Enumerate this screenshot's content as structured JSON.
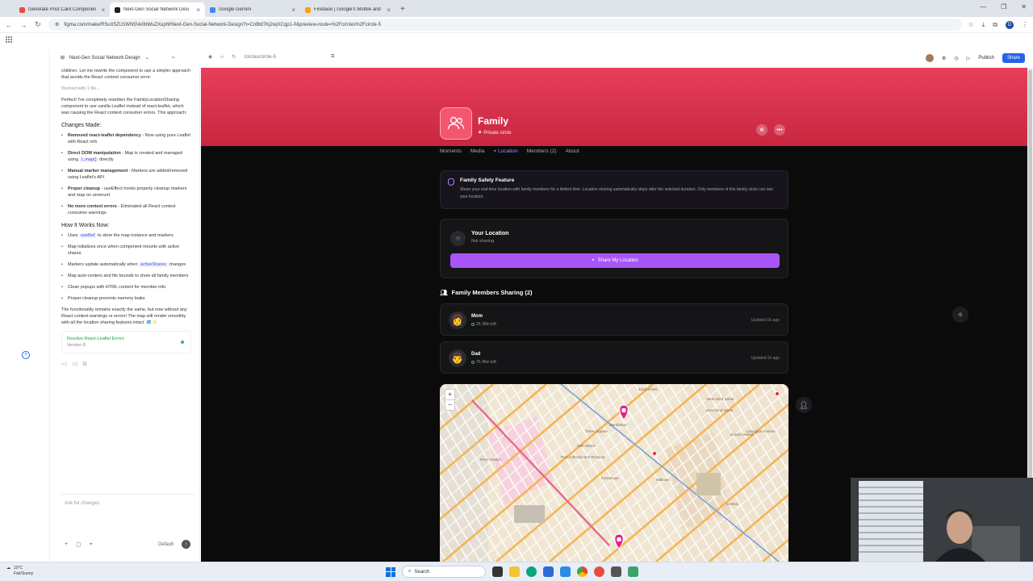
{
  "browser": {
    "tabs": [
      {
        "title": "Generate Post Card Componen",
        "color": "#e84c3d",
        "active": false
      },
      {
        "title": "Next-Gen Social Network Desi",
        "color": "#1e1e1e",
        "active": true
      },
      {
        "title": "Google Gemini",
        "color": "#4285f4",
        "active": false
      },
      {
        "title": "Firebase | Google's Mobile and",
        "color": "#ffa000",
        "active": false
      }
    ],
    "url": "figma.com/make/RSuX5ZU1WN5Ve0bWuZXuphf/Next-Gen-Social-Network-Design?t=CnBld7Kj2wjXCqp1-0&preview-route=%2Fcircles%2Fcircle-5"
  },
  "figma": {
    "project_name": "Next-Gen Social Network Design",
    "route": "/circles/circle-5",
    "publish_label": "Publish",
    "share_label": "Share"
  },
  "chat": {
    "intro": "children. Let me rewrite the component to use a simpler approach that avoids the React context consumer error:",
    "worked": "Worked with 1 file  ›",
    "summary": "Perfect! I've completely rewritten the FamilyLocationSharing component to use vanilla Leaflet instead of react-leaflet, which was causing the React context consumer errors. This approach:",
    "changes_heading": "Changes Made:",
    "changes": [
      {
        "bold": "Removed react-leaflet dependency",
        "text": " - Now using pure Leaflet with React refs"
      },
      {
        "bold": "Direct DOM manipulation",
        "text": " - Map is created and managed using ",
        "code": "L.map()",
        "after": " directly"
      },
      {
        "bold": "Manual marker management",
        "text": " - Markers are added/removed using Leaflet's API"
      },
      {
        "bold": "Proper cleanup",
        "text": " - useEffect hooks properly cleanup markers and map on unmount"
      },
      {
        "bold": "No more context errors",
        "text": " - Eliminated all React context consumer warnings"
      }
    ],
    "how_heading": "How It Works Now:",
    "how": [
      {
        "text": "Uses ",
        "code": "useRef",
        "after": " to store the map instance and markers"
      },
      {
        "text": "Map initializes once when component mounts with active shares"
      },
      {
        "text": "Markers update automatically when ",
        "code": "activeShares",
        "after": " changes"
      },
      {
        "text": "Map auto-centers and fits bounds to show all family members"
      },
      {
        "text": "Clean popups with HTML content for member info"
      },
      {
        "text": "Proper cleanup prevents memory leaks"
      }
    ],
    "closing": "The functionality remains exactly the same, but now without any React context warnings or errors! The map will render smoothly with all the location sharing features intact. 🗺️✨",
    "version_title": "Resolve React-Leaflet Errors",
    "version_sub": "Version 8",
    "input_placeholder": "Ask for changes",
    "model_label": "Default"
  },
  "app": {
    "group_name": "Family",
    "group_privacy": "Private circle",
    "tabs": [
      {
        "label": "Moments",
        "active": false
      },
      {
        "label": "Media",
        "active": false
      },
      {
        "label": "Location",
        "active": true
      },
      {
        "label": "Members (2)",
        "active": false
      },
      {
        "label": "About",
        "active": false
      }
    ],
    "safety": {
      "title": "Family Safety Feature",
      "body": "Share your real-time location with family members for a limited time. Location sharing automatically stops after the selected duration. Only members of this family circle can see your location."
    },
    "your_location": {
      "title": "Your Location",
      "status": "Not sharing",
      "button": "Share My Location"
    },
    "sharing_heading": "Family Members Sharing (2)",
    "members": [
      {
        "name": "Mom",
        "time_left": "2h 30m left",
        "updated": "Updated 0s ago",
        "emoji": "👩"
      },
      {
        "name": "Dad",
        "time_left": "7h 45m left",
        "updated": "Updated 2s ago",
        "emoji": "👨"
      }
    ],
    "map": {
      "labels": [
        "Manhattan",
        "42nd Street",
        "34th Street",
        "Midtown",
        "Grand Central",
        "Port Authority Bus Terminal",
        "Penn Station",
        "West 42nd Street",
        "East 42nd Street",
        "Lexington Avenue",
        "Koreatown",
        "Times Square",
        "Central"
      ]
    }
  },
  "os": {
    "weather_temp": "10°C",
    "weather_desc": "Fair/Sunny",
    "search_label": "Search"
  },
  "colors": {
    "hero": "#e83f5b",
    "accent": "#a855f7",
    "tab_active": "#a78bfa"
  }
}
